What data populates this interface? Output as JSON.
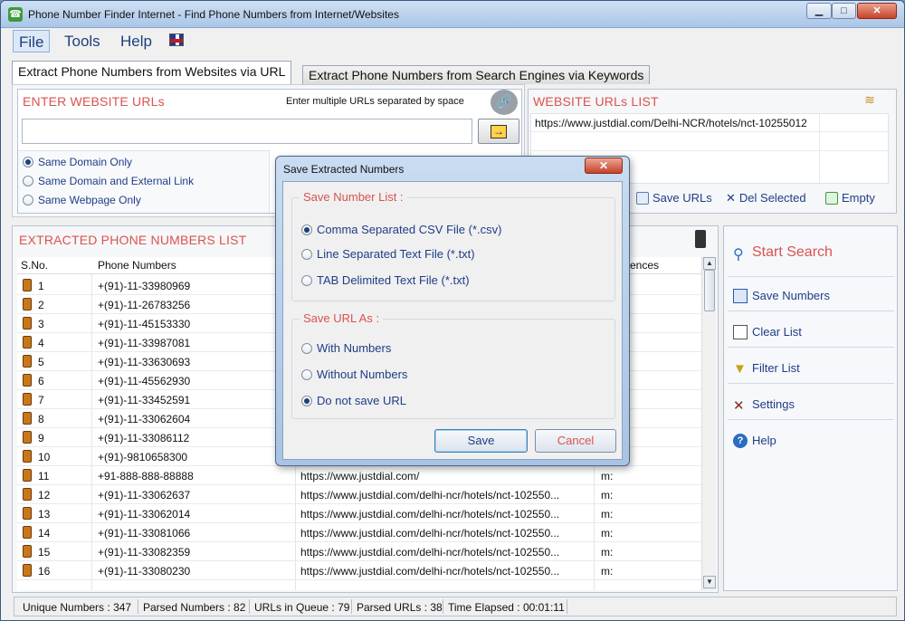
{
  "window": {
    "title": "Phone Number Finder Internet - Find Phone Numbers from Internet/Websites",
    "min_glyph": "▁",
    "max_glyph": "□",
    "close_glyph": "✕"
  },
  "menu": [
    "File",
    "Tools",
    "Help"
  ],
  "tabs": [
    "Extract Phone Numbers from Websites via URL",
    "Extract Phone Numbers from Search Engines via Keywords"
  ],
  "enter_urls": {
    "title": "ENTER WEBSITE URLs",
    "hint": "Enter multiple URLs separated by space",
    "input_value": "",
    "go_glyph": "→",
    "link_glyph": "🔗",
    "options": [
      "Same Domain Only",
      "Same Domain and External Link",
      "Same Webpage Only"
    ],
    "selected": 0
  },
  "url_list": {
    "title": "WEBSITE URLs LIST",
    "items": [
      "https://www.justdial.com/Delhi-NCR/hotels/nct-10255012"
    ],
    "actions": [
      "Save URLs",
      "Del Selected",
      "Empty"
    ]
  },
  "phones": {
    "title": "EXTRACTED PHONE NUMBERS LIST",
    "columns": [
      "S.No.",
      "Phone Numbers",
      "",
      "ences"
    ],
    "rows": [
      {
        "sno": "1",
        "phone": "+(91)-11-33980969",
        "url": "",
        "occ": ""
      },
      {
        "sno": "2",
        "phone": "+(91)-11-26783256",
        "url": "",
        "occ": ""
      },
      {
        "sno": "3",
        "phone": "+(91)-11-45153330",
        "url": "",
        "occ": ""
      },
      {
        "sno": "4",
        "phone": "+(91)-11-33987081",
        "url": "",
        "occ": ""
      },
      {
        "sno": "5",
        "phone": "+(91)-11-33630693",
        "url": "",
        "occ": ""
      },
      {
        "sno": "6",
        "phone": "+(91)-11-45562930",
        "url": "",
        "occ": ""
      },
      {
        "sno": "7",
        "phone": "+(91)-11-33452591",
        "url": "",
        "occ": ""
      },
      {
        "sno": "8",
        "phone": "+(91)-11-33062604",
        "url": "",
        "occ": ""
      },
      {
        "sno": "9",
        "phone": "+(91)-11-33086112",
        "url": "",
        "occ": ""
      },
      {
        "sno": "10",
        "phone": "+(91)-9810658300",
        "url": "",
        "occ": ""
      },
      {
        "sno": "11",
        "phone": "+91-888-888-88888",
        "url": "https://www.justdial.com/",
        "occ": "m:"
      },
      {
        "sno": "12",
        "phone": "+(91)-11-33062637",
        "url": "https://www.justdial.com/delhi-ncr/hotels/nct-102550...",
        "occ": "m:"
      },
      {
        "sno": "13",
        "phone": "+(91)-11-33062014",
        "url": "https://www.justdial.com/delhi-ncr/hotels/nct-102550...",
        "occ": "m:"
      },
      {
        "sno": "14",
        "phone": "+(91)-11-33081066",
        "url": "https://www.justdial.com/delhi-ncr/hotels/nct-102550...",
        "occ": "m:"
      },
      {
        "sno": "15",
        "phone": "+(91)-11-33082359",
        "url": "https://www.justdial.com/delhi-ncr/hotels/nct-102550...",
        "occ": "m:"
      },
      {
        "sno": "16",
        "phone": "+(91)-11-33080230",
        "url": "https://www.justdial.com/delhi-ncr/hotels/nct-102550...",
        "occ": "m:"
      }
    ]
  },
  "sidebar": {
    "start": "Start Search",
    "items": [
      "Save Numbers",
      "Clear List",
      "Filter List",
      "Settings",
      "Help"
    ]
  },
  "status": {
    "unique_label": "Unique Numbers :",
    "unique": "347",
    "parsed_label": "Parsed Numbers :",
    "parsed": "82",
    "queue_label": "URLs in Queue :",
    "queue": "79",
    "parsed_urls_label": "Parsed URLs :",
    "parsed_urls": "38",
    "elapsed_label": "Time Elapsed :",
    "elapsed": "00:01:11"
  },
  "dialog": {
    "title": "Save Extracted Numbers",
    "close_glyph": "✕",
    "group1": "Save Number List :",
    "group1_options": [
      "Comma Separated CSV File (*.csv)",
      "Line Separated Text File (*.txt)",
      "TAB Delimited Text File (*.txt)"
    ],
    "group1_selected": 0,
    "group2": "Save URL As  :",
    "group2_options": [
      "With Numbers",
      "Without Numbers",
      "Do not save URL"
    ],
    "group2_selected": 2,
    "save": "Save",
    "cancel": "Cancel"
  },
  "colors": {
    "accent_red": "#d9534f",
    "link_blue": "#1f3d86"
  }
}
